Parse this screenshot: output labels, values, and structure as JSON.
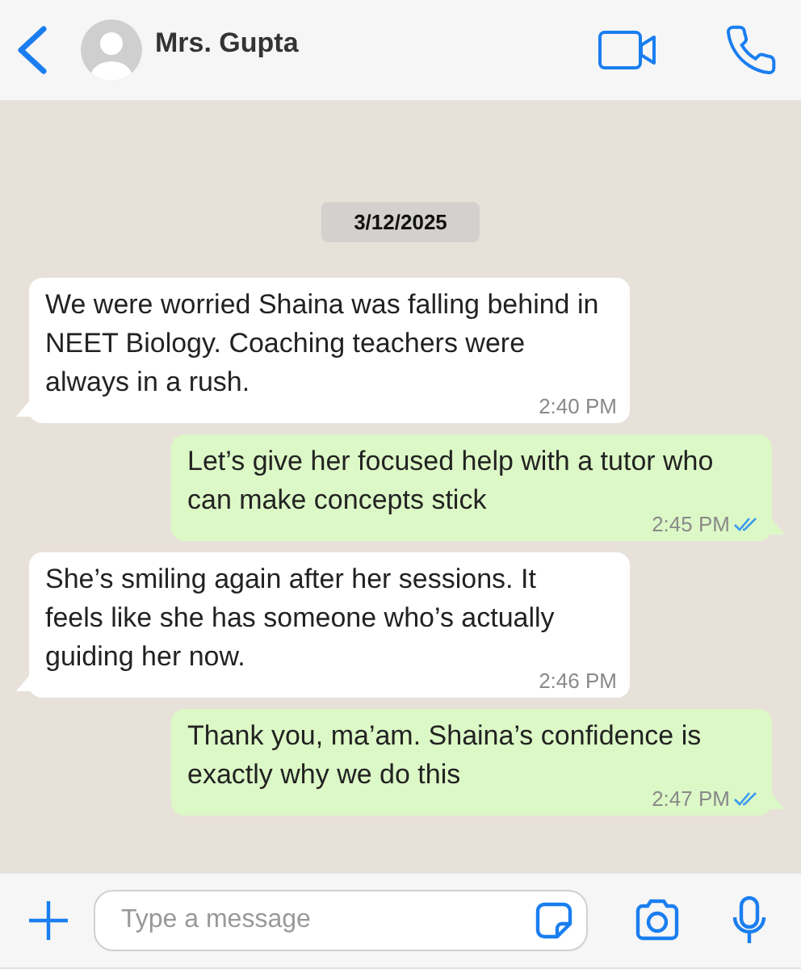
{
  "header": {
    "contact_name": "Mrs. Gupta"
  },
  "date_chip": "3/12/2025",
  "messages": [
    {
      "kind": "incoming",
      "text": "We were worried Shaina was falling behind in NEET Biology. Coaching teachers were always in a rush.",
      "time": "2:40 PM"
    },
    {
      "kind": "outgoing",
      "text": "Let’s give her focused help with a tutor who can make concepts stick",
      "time": "2:45 PM",
      "read": true
    },
    {
      "kind": "incoming",
      "text": "She’s smiling again after her sessions. It feels like she has someone who’s actually guiding her now.",
      "time": "2:46 PM"
    },
    {
      "kind": "outgoing",
      "text": "Thank you, ma’am. Shaina’s confidence is exactly why we do this",
      "time": "2:47 PM",
      "read": true
    }
  ],
  "composer": {
    "placeholder": "Type a message"
  }
}
